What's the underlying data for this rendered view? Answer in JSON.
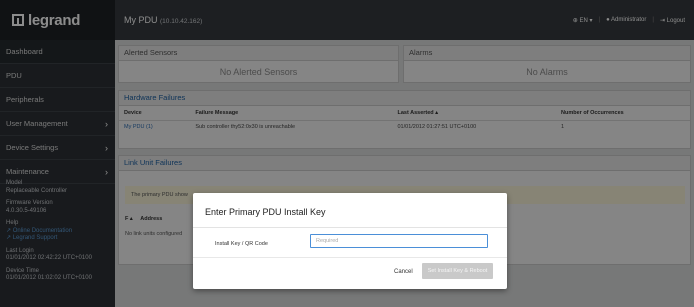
{
  "brand": "legrand",
  "nav": [
    {
      "label": "Dashboard",
      "arrow": false
    },
    {
      "label": "PDU",
      "arrow": false
    },
    {
      "label": "Peripherals",
      "arrow": false
    },
    {
      "label": "User Management",
      "arrow": true
    },
    {
      "label": "Device Settings",
      "arrow": true
    },
    {
      "label": "Maintenance",
      "arrow": true
    }
  ],
  "sidebar_info": {
    "model_label": "Model",
    "model_value": "Replaceable Controller",
    "firmware_label": "Firmware Version",
    "firmware_value": "4.0.30.5-49106",
    "help_label": "Help",
    "online_doc": "Online Documentation",
    "legrand_support": "Legrand Support",
    "last_login_label": "Last Login",
    "last_login_value": "01/01/2012 02:42:22 UTC+0100",
    "device_time_label": "Device Time",
    "device_time_value": "01/01/2012 01:02:02 UTC+0100"
  },
  "header": {
    "title": "My PDU",
    "ip": "(10.10.42.162)",
    "lang": "EN ▾",
    "user": "Administrator",
    "logout": "Logout"
  },
  "alerted": {
    "title": "Alerted Sensors",
    "empty": "No Alerted Sensors"
  },
  "alarms": {
    "title": "Alarms",
    "empty": "No Alarms"
  },
  "hardware": {
    "title": "Hardware Failures",
    "columns": [
      "Device",
      "Failure Message",
      "Last Asserted ▴",
      "Number of Occurrences"
    ],
    "rows": [
      [
        "My PDU (1)",
        "Sub controller thy52:0x30 is unreachable",
        "01/01/2012 01:27:51 UTC+0100",
        "1"
      ]
    ]
  },
  "link_unit": {
    "title": "Link Unit Failures",
    "notice": "The primary PDU show",
    "col1": "F ▴",
    "col2": "Address",
    "empty": "No link units configured"
  },
  "modal": {
    "title": "Enter Primary PDU Install Key",
    "label": "Install Key / QR Code",
    "placeholder": "Required",
    "cancel": "Cancel",
    "submit": "Set Install Key & Reboot"
  }
}
